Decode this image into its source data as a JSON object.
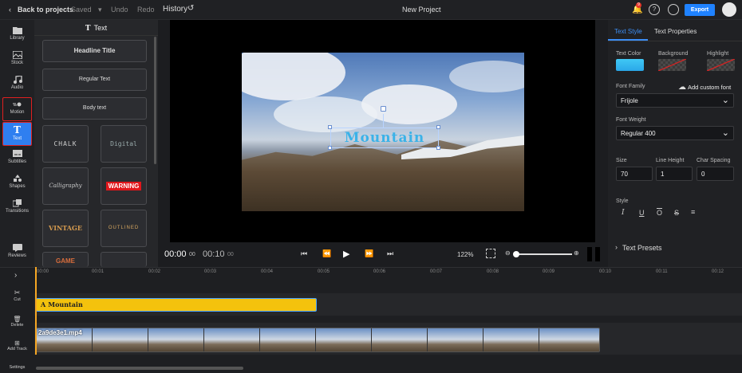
{
  "topbar": {
    "back_label": "Back to projects",
    "saved_label": "Saved",
    "undo_label": "Undo",
    "redo_label": "Redo",
    "history_label": "History",
    "project_title": "New Project",
    "notification_count": "9",
    "export_label": "Export",
    "accent": "#1f82ff"
  },
  "nav": {
    "items": [
      {
        "label": "Library",
        "icon": "folder-icon"
      },
      {
        "label": "Stock",
        "icon": "stock-icon"
      },
      {
        "label": "Audio",
        "icon": "music-note-icon"
      },
      {
        "label": "Motion",
        "icon": "motion-icon"
      },
      {
        "label": "Text",
        "icon": "text-t-icon"
      },
      {
        "label": "Subtitles",
        "icon": "subtitles-icon"
      },
      {
        "label": "Shapes",
        "icon": "shapes-icon"
      },
      {
        "label": "Transitions",
        "icon": "transitions-icon"
      },
      {
        "label": "Reviews",
        "icon": "reviews-icon"
      }
    ]
  },
  "text_panel": {
    "title": "Text",
    "headline": "Headline Title",
    "regular": "Regular Text",
    "body": "Body text",
    "styles": [
      "CHALK",
      "Digital",
      "Calligraphy",
      "WARNING",
      "VINTAGE",
      "OUTLINED",
      "GAME",
      ""
    ]
  },
  "canvas": {
    "overlay_text": "Mountain"
  },
  "playback": {
    "current_time": "00:00",
    "current_frames": "00",
    "total_time": "00:10",
    "total_frames": "00",
    "zoom": "122%"
  },
  "properties": {
    "tab_style": "Text Style",
    "tab_props": "Text Properties",
    "text_color_label": "Text Color",
    "background_label": "Background",
    "highlight_label": "Highlight",
    "text_color": "#3bc1f0",
    "font_family_label": "Font Family",
    "add_font_label": "Add custom font",
    "font_family": "Frijole",
    "font_weight_label": "Font Weight",
    "font_weight": "Regular 400",
    "size_label": "Size",
    "size": "70",
    "line_height_label": "Line Height",
    "line_height": "1",
    "char_spacing_label": "Char Spacing",
    "char_spacing": "0",
    "style_label": "Style",
    "presets_label": "Text Presets"
  },
  "timeline": {
    "ticks": [
      "00:00",
      "00:01",
      "00:02",
      "00:03",
      "00:04",
      "00:05",
      "00:06",
      "00:07",
      "00:08",
      "00:09",
      "00:10",
      "00:11",
      "00:12"
    ],
    "cut_label": "Cut",
    "delete_label": "Delete",
    "add_track_label": "Add Track",
    "settings_label": "Settings",
    "text_clip_label": "Mountain",
    "video_clip_label": "2a9de3e1.mp4"
  }
}
